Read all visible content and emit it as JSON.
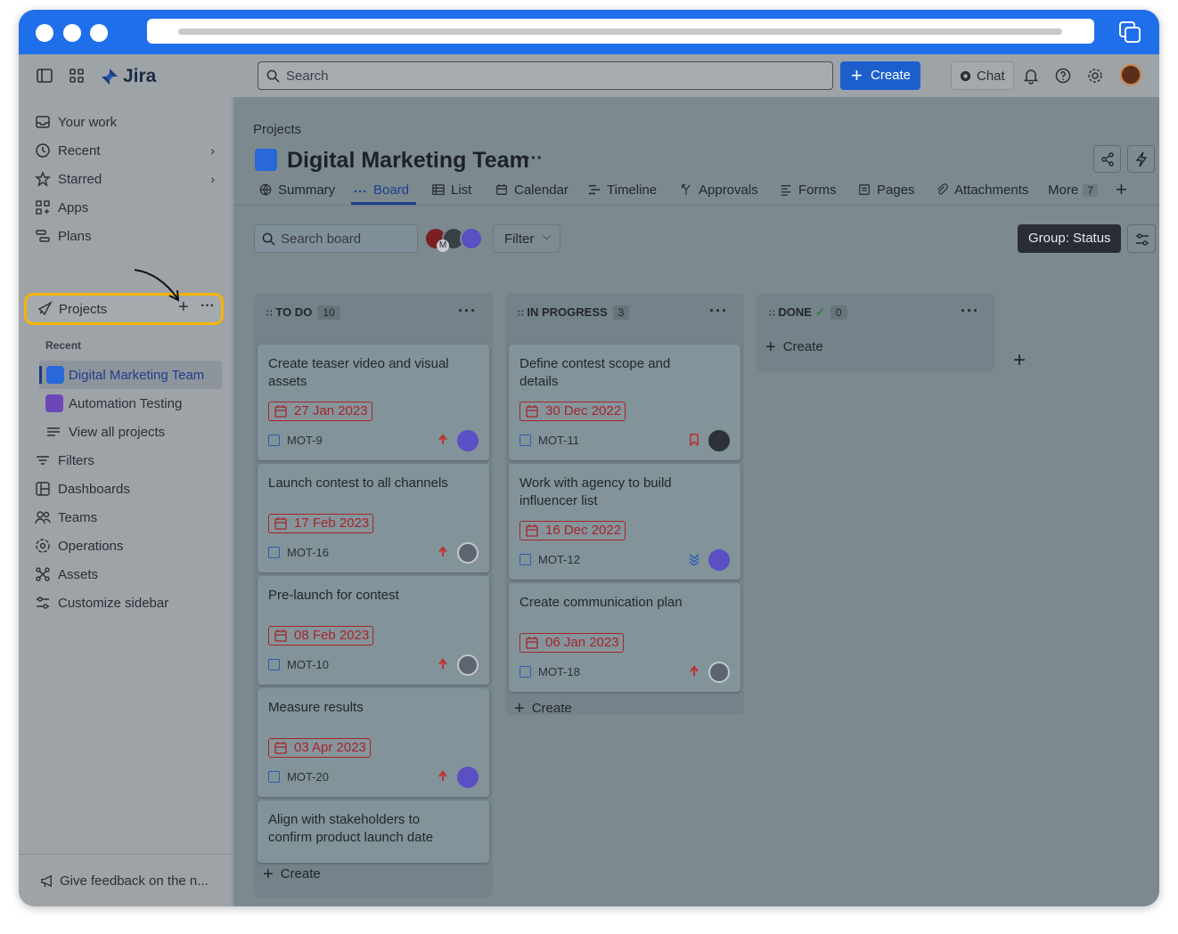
{
  "topnav": {
    "logo_text": "Jira",
    "search_placeholder": "Search",
    "create_label": "Create",
    "chat_label": "Chat"
  },
  "sidebar": {
    "items": [
      {
        "label": "Your work"
      },
      {
        "label": "Recent"
      },
      {
        "label": "Starred"
      },
      {
        "label": "Apps"
      },
      {
        "label": "Plans"
      },
      {
        "label": "Projects"
      },
      {
        "label": "Filters"
      },
      {
        "label": "Dashboards"
      },
      {
        "label": "Teams"
      },
      {
        "label": "Operations"
      },
      {
        "label": "Assets"
      },
      {
        "label": "Customize sidebar"
      }
    ],
    "recent_label": "Recent",
    "recent_projects": [
      {
        "label": "Digital Marketing Team"
      },
      {
        "label": "Automation Testing"
      },
      {
        "label": "View all projects"
      }
    ],
    "feedback_label": "Give feedback on the n..."
  },
  "header": {
    "breadcrumb": "Projects",
    "title": "Digital Marketing Team",
    "tabs": [
      {
        "label": "Summary"
      },
      {
        "label": "Board"
      },
      {
        "label": "List"
      },
      {
        "label": "Calendar"
      },
      {
        "label": "Timeline"
      },
      {
        "label": "Approvals"
      },
      {
        "label": "Forms"
      },
      {
        "label": "Pages"
      },
      {
        "label": "Attachments"
      },
      {
        "label": "More",
        "count": "7"
      }
    ]
  },
  "toolbar": {
    "search_placeholder": "Search board",
    "filter_label": "Filter",
    "group_label": "Group: Status",
    "avatar_initial": "M"
  },
  "columns": [
    {
      "name": "TO DO",
      "count": "10",
      "cards": [
        {
          "title": "Create teaser video and visual assets",
          "date": "27 Jan 2023",
          "key": "MOT-9",
          "priority": "high"
        },
        {
          "title": "Launch contest to all channels",
          "date": "17 Feb 2023",
          "key": "MOT-16",
          "priority": "high"
        },
        {
          "title": "Pre-launch for contest",
          "date": "08 Feb 2023",
          "key": "MOT-10",
          "priority": "high"
        },
        {
          "title": "Measure results",
          "date": "03 Apr 2023",
          "key": "MOT-20",
          "priority": "high"
        },
        {
          "title": "Align with stakeholders to confirm product launch date",
          "date": "",
          "key": "",
          "priority": ""
        }
      ],
      "create_label": "Create"
    },
    {
      "name": "IN PROGRESS",
      "count": "3",
      "cards": [
        {
          "title": "Define contest scope and details",
          "date": "30 Dec 2022",
          "key": "MOT-11",
          "priority": "flag"
        },
        {
          "title": "Work with agency to build influencer list",
          "date": "16 Dec 2022",
          "key": "MOT-12",
          "priority": "lowest"
        },
        {
          "title": "Create communication plan",
          "date": "06 Jan 2023",
          "key": "MOT-18",
          "priority": "high"
        }
      ],
      "create_label": "Create"
    },
    {
      "name": "DONE",
      "count": "0",
      "cards": [],
      "create_label": "Create"
    }
  ],
  "colors": {
    "accent": "#1c5fcc",
    "highlight": "#f5b400",
    "date_red": "#a3262c"
  }
}
